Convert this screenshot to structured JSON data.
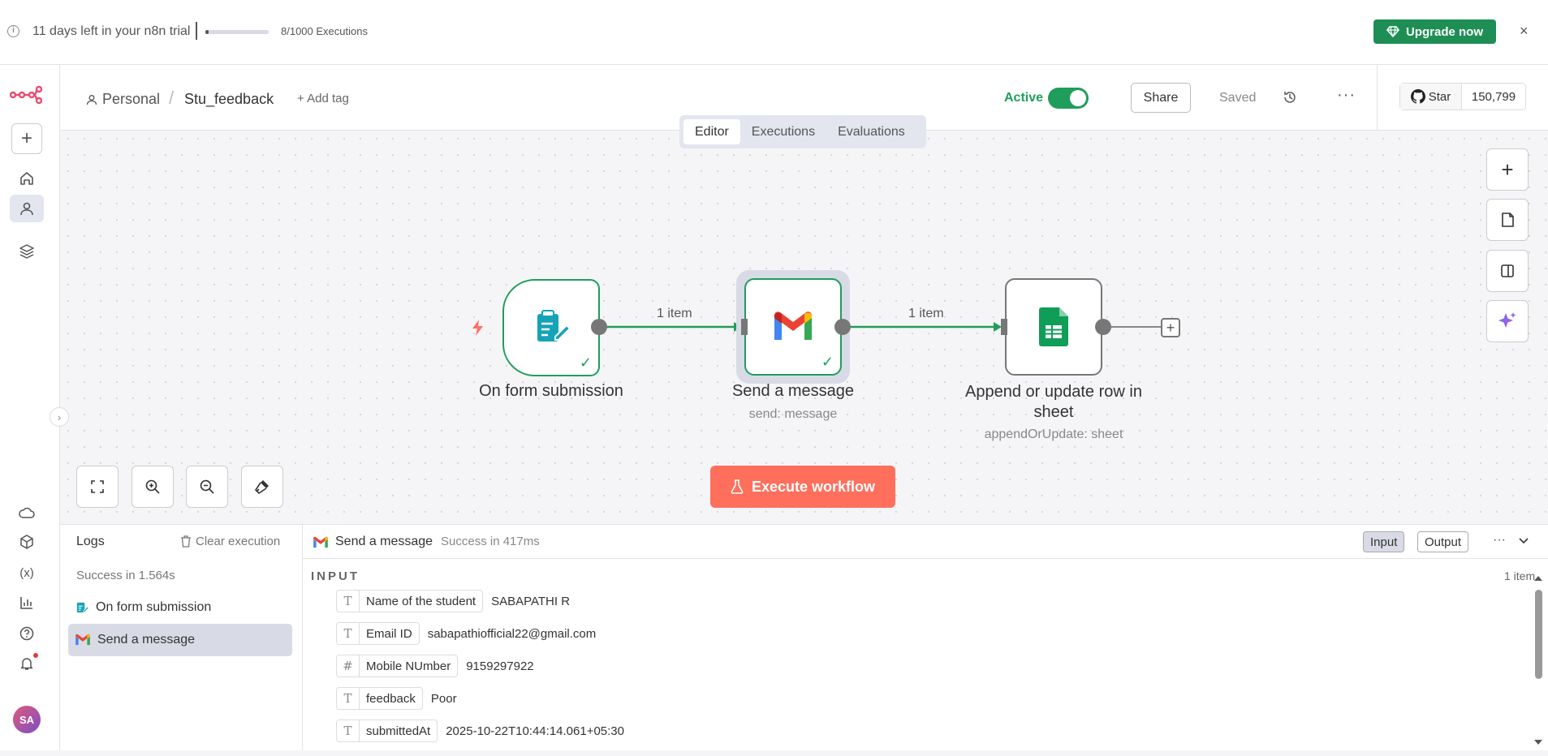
{
  "banner": {
    "trial_text": "11 days left in your n8n trial",
    "executions_text": "8/1000 Executions",
    "executions_used": 8,
    "executions_limit": 1000,
    "upgrade_label": "Upgrade now",
    "close_label": "×"
  },
  "header": {
    "project": "Personal",
    "workflow_name": "Stu_feedback",
    "add_tag": "+ Add tag",
    "active_label": "Active",
    "active": true,
    "share_label": "Share",
    "saved_label": "Saved",
    "github_star": "Star",
    "github_count": "150,799"
  },
  "tabs": [
    "Editor",
    "Executions",
    "Evaluations"
  ],
  "canvas": {
    "nodes": [
      {
        "name": "On form submission",
        "subtitle": "",
        "icon": "form-icon"
      },
      {
        "name": "Send a message",
        "subtitle": "send: message",
        "icon": "gmail-icon"
      },
      {
        "name": "Append or update row in sheet",
        "subtitle": "appendOrUpdate: sheet",
        "icon": "google-sheets-icon"
      }
    ],
    "edges": [
      {
        "label": "1 item"
      },
      {
        "label": "1 item"
      }
    ],
    "execute_label": "Execute workflow"
  },
  "logs": {
    "title": "Logs",
    "clear_label": "Clear execution",
    "summary": "Success in 1.564s",
    "items": [
      {
        "label": "On form submission",
        "icon": "form-icon"
      },
      {
        "label": "Send a message",
        "icon": "gmail-icon"
      }
    ]
  },
  "panel": {
    "node_name": "Send a message",
    "status": "Success in 417ms",
    "input_label": "Input",
    "output_label": "Output",
    "section_title": "INPUT",
    "items_count": "1 item",
    "fields": [
      {
        "type": "T",
        "name": "Name of the student",
        "value": "SABAPATHI R"
      },
      {
        "type": "T",
        "name": "Email ID",
        "value": "sabapathiofficial22@gmail.com"
      },
      {
        "type": "#",
        "name": "Mobile NUmber",
        "value": "9159297922"
      },
      {
        "type": "T",
        "name": "feedback",
        "value": "Poor"
      },
      {
        "type": "T",
        "name": "submittedAt",
        "value": "2025-10-22T10:44:14.061+05:30"
      }
    ]
  },
  "user": {
    "initials": "SA"
  },
  "colors": {
    "brand": "#ea4b71",
    "success": "#1e9e5a",
    "execute": "#ff6f5c",
    "upgrade": "#1e8e55"
  }
}
